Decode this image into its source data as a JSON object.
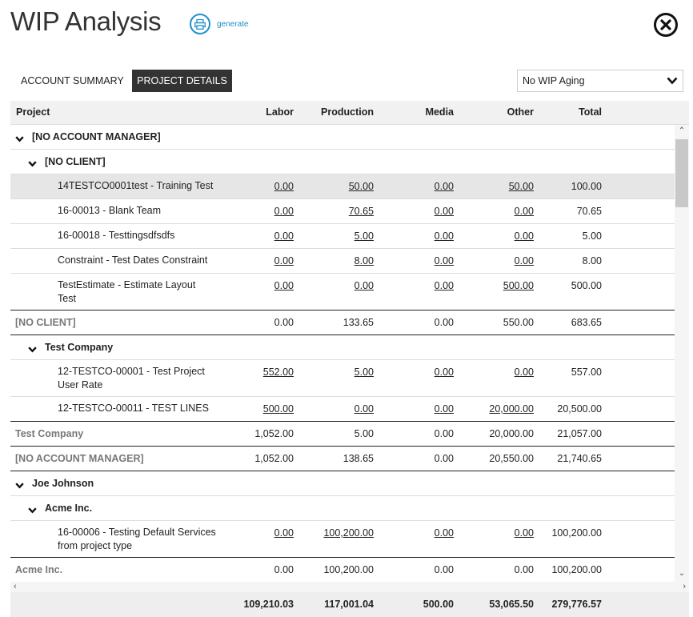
{
  "page": {
    "title": "WIP Analysis",
    "generate_label": "generate"
  },
  "tabs": [
    {
      "label": "ACCOUNT SUMMARY",
      "active": false
    },
    {
      "label": "PROJECT DETAILS",
      "active": true
    }
  ],
  "aging_select": {
    "value": "No WIP Aging"
  },
  "columns": [
    "Project",
    "Labor",
    "Production",
    "Media",
    "Other",
    "Total"
  ],
  "rows": [
    {
      "type": "group1",
      "label": "[NO ACCOUNT MANAGER]"
    },
    {
      "type": "group2",
      "label": "[NO CLIENT]"
    },
    {
      "type": "project",
      "highlight": true,
      "label": [
        "14TESTCO0001test - Training Test"
      ],
      "labor": "0.00",
      "production": "50.00",
      "media": "0.00",
      "other": "50.00",
      "total": "100.00"
    },
    {
      "type": "project",
      "label": [
        "16-00013 - Blank Team"
      ],
      "labor": "0.00",
      "production": "70.65",
      "media": "0.00",
      "other": "0.00",
      "total": "70.65"
    },
    {
      "type": "project",
      "label": [
        "16-00018 - Testtingsdfsdfs"
      ],
      "labor": "0.00",
      "production": "5.00",
      "media": "0.00",
      "other": "0.00",
      "total": "5.00"
    },
    {
      "type": "project",
      "label": [
        "Constraint - Test Dates Constraint"
      ],
      "labor": "0.00",
      "production": "8.00",
      "media": "0.00",
      "other": "0.00",
      "total": "8.00"
    },
    {
      "type": "project",
      "last": true,
      "label": [
        "TestEstimate - Estimate Layout",
        "Test"
      ],
      "labor": "0.00",
      "production": "0.00",
      "media": "0.00",
      "other": "500.00",
      "total": "500.00"
    },
    {
      "type": "subtotal",
      "label": "[NO CLIENT]",
      "labor": "0.00",
      "production": "133.65",
      "media": "0.00",
      "other": "550.00",
      "total": "683.65"
    },
    {
      "type": "group2",
      "label": "Test Company"
    },
    {
      "type": "project",
      "label": [
        "12-TESTCO-00001 - Test Project",
        "User Rate"
      ],
      "labor": "552.00",
      "production": "5.00",
      "media": "0.00",
      "other": "0.00",
      "total": "557.00"
    },
    {
      "type": "project",
      "last": true,
      "label": [
        "12-TESTCO-00011 - TEST LINES"
      ],
      "labor": "500.00",
      "production": "0.00",
      "media": "0.00",
      "other": "20,000.00",
      "total": "20,500.00"
    },
    {
      "type": "subtotal",
      "label": "Test Company",
      "labor": "1,052.00",
      "production": "5.00",
      "media": "0.00",
      "other": "20,000.00",
      "total": "21,057.00"
    },
    {
      "type": "subtotal",
      "label": "[NO ACCOUNT MANAGER]",
      "labor": "1,052.00",
      "production": "138.65",
      "media": "0.00",
      "other": "20,550.00",
      "total": "21,740.65"
    },
    {
      "type": "group1",
      "label": "Joe Johnson"
    },
    {
      "type": "group2",
      "label": "Acme Inc."
    },
    {
      "type": "project",
      "last": true,
      "label": [
        "16-00006 - Testing Default Services",
        "from project type"
      ],
      "labor": "0.00",
      "production": "100,200.00",
      "media": "0.00",
      "other": "0.00",
      "total": "100,200.00"
    },
    {
      "type": "subtotal",
      "label": "Acme Inc.",
      "labor": "0.00",
      "production": "100,200.00",
      "media": "0.00",
      "other": "0.00",
      "total": "100,200.00"
    }
  ],
  "totals": {
    "labor": "109,210.03",
    "production": "117,001.04",
    "media": "500.00",
    "other": "53,065.50",
    "total": "279,776.57"
  }
}
